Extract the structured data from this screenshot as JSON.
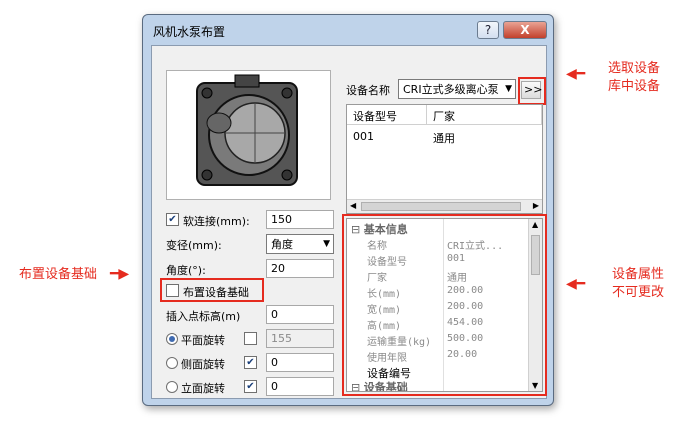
{
  "window": {
    "title": "风机水泵布置",
    "help_label": "?",
    "close_label": "X"
  },
  "left": {
    "soft_connect": {
      "label": "软连接(mm):",
      "checked": true,
      "value": "150"
    },
    "reduce": {
      "label": "变径(mm):",
      "selected": "角度"
    },
    "angle": {
      "label": "角度(°):",
      "value": "20"
    },
    "place_base": {
      "label": "布置设备基础",
      "checked": false
    },
    "insert_elev": {
      "label": "插入点标高(m)",
      "value": "0"
    },
    "rotations": [
      {
        "label": "平面旋转",
        "selected": true,
        "checked": false,
        "value": "155",
        "disabled": true
      },
      {
        "label": "侧面旋转",
        "selected": false,
        "checked": true,
        "value": "0",
        "disabled": false
      },
      {
        "label": "立面旋转",
        "selected": false,
        "checked": true,
        "value": "0",
        "disabled": false
      }
    ]
  },
  "right": {
    "device_name_label": "设备名称",
    "device_name_value": "CRI立式多级离心泵",
    "pick_button": ">>",
    "list": {
      "columns": [
        "设备型号",
        "厂家"
      ],
      "rows": [
        [
          "001",
          "通用"
        ]
      ]
    },
    "properties": {
      "group1": "基本信息",
      "rows": [
        {
          "k": "名称",
          "v": "CRI立式..."
        },
        {
          "k": "设备型号",
          "v": "001"
        },
        {
          "k": "厂家",
          "v": "通用"
        },
        {
          "k": "长(mm)",
          "v": "200.00"
        },
        {
          "k": "宽(mm)",
          "v": "200.00"
        },
        {
          "k": "高(mm)",
          "v": "454.00"
        },
        {
          "k": "运输重量(kg)",
          "v": "500.00"
        },
        {
          "k": "使用年限",
          "v": "20.00"
        }
      ],
      "editable_row": "设备编号",
      "group2": "设备基础"
    }
  },
  "annotations": {
    "pick": [
      "选取设备",
      "库中设备"
    ],
    "base": "布置设备基础",
    "props": [
      "设备属性",
      "不可更改"
    ]
  }
}
